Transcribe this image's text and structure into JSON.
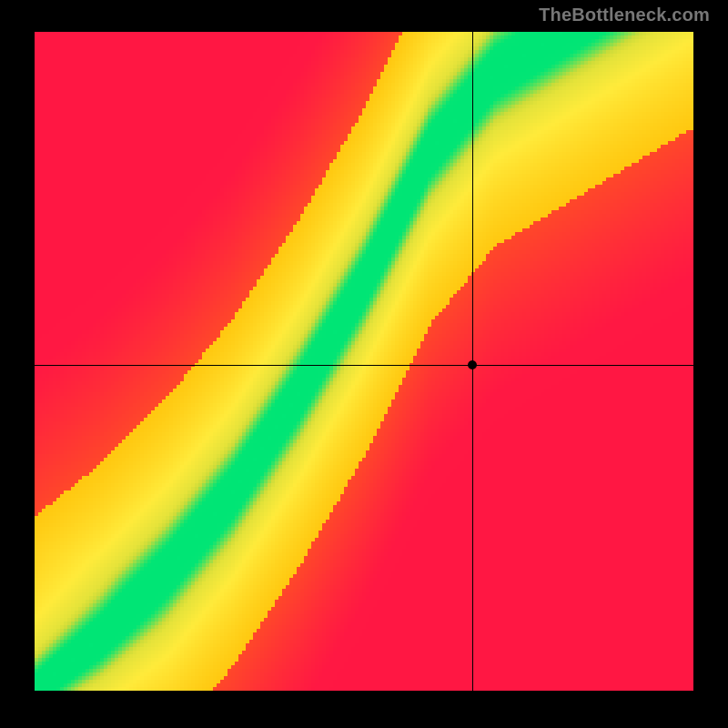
{
  "watermark": "TheBottleneck.com",
  "chart_data": {
    "type": "heatmap",
    "title": "",
    "xlabel": "",
    "ylabel": "",
    "xlim": [
      0,
      1
    ],
    "ylim": [
      0,
      1
    ],
    "grid": false,
    "legend": "none",
    "resolution": 181,
    "color_scale": {
      "stops": [
        {
          "t": 0.0,
          "color": "#ff1744"
        },
        {
          "t": 0.25,
          "color": "#ff5722"
        },
        {
          "t": 0.5,
          "color": "#ffc107"
        },
        {
          "t": 0.7,
          "color": "#ffeb3b"
        },
        {
          "t": 0.85,
          "color": "#cddc39"
        },
        {
          "t": 1.0,
          "color": "#00e676"
        }
      ]
    },
    "ideal_curve": {
      "description": "y as function of x where score is maximal (green ridge)",
      "points": [
        {
          "x": 0.0,
          "y": 0.0
        },
        {
          "x": 0.1,
          "y": 0.08
        },
        {
          "x": 0.2,
          "y": 0.18
        },
        {
          "x": 0.3,
          "y": 0.3
        },
        {
          "x": 0.4,
          "y": 0.45
        },
        {
          "x": 0.5,
          "y": 0.62
        },
        {
          "x": 0.55,
          "y": 0.72
        },
        {
          "x": 0.6,
          "y": 0.82
        },
        {
          "x": 0.7,
          "y": 0.94
        },
        {
          "x": 0.8,
          "y": 1.0
        }
      ],
      "band_width": 0.055
    },
    "crosshair": {
      "x": 0.665,
      "y": 0.495
    },
    "marker": {
      "x": 0.665,
      "y": 0.495
    },
    "score_at_marker": 0.35
  },
  "colors": {
    "frame": "#000000",
    "watermark": "#777777"
  }
}
